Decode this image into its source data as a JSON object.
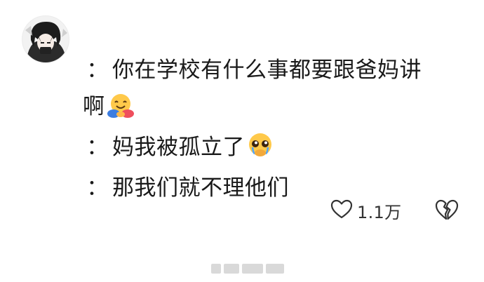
{
  "comment": {
    "lines": [
      {
        "prefix": "：",
        "text": "你在学校有什么事都要跟爸妈讲"
      },
      {
        "prefix": "",
        "text": "啊",
        "emoji": "hugging-face-emoji"
      },
      {
        "prefix": "：",
        "text": "妈我被孤立了",
        "emoji": "pleading-face-emoji"
      },
      {
        "prefix": "：",
        "text": "那我们就不理他们"
      }
    ]
  },
  "actions": {
    "like_icon": "heart-outline-icon",
    "like_count": "1.1万",
    "dislike_icon": "broken-heart-icon"
  },
  "colors": {
    "text": "#1a1a1a",
    "icon": "#333333",
    "background": "#ffffff"
  }
}
